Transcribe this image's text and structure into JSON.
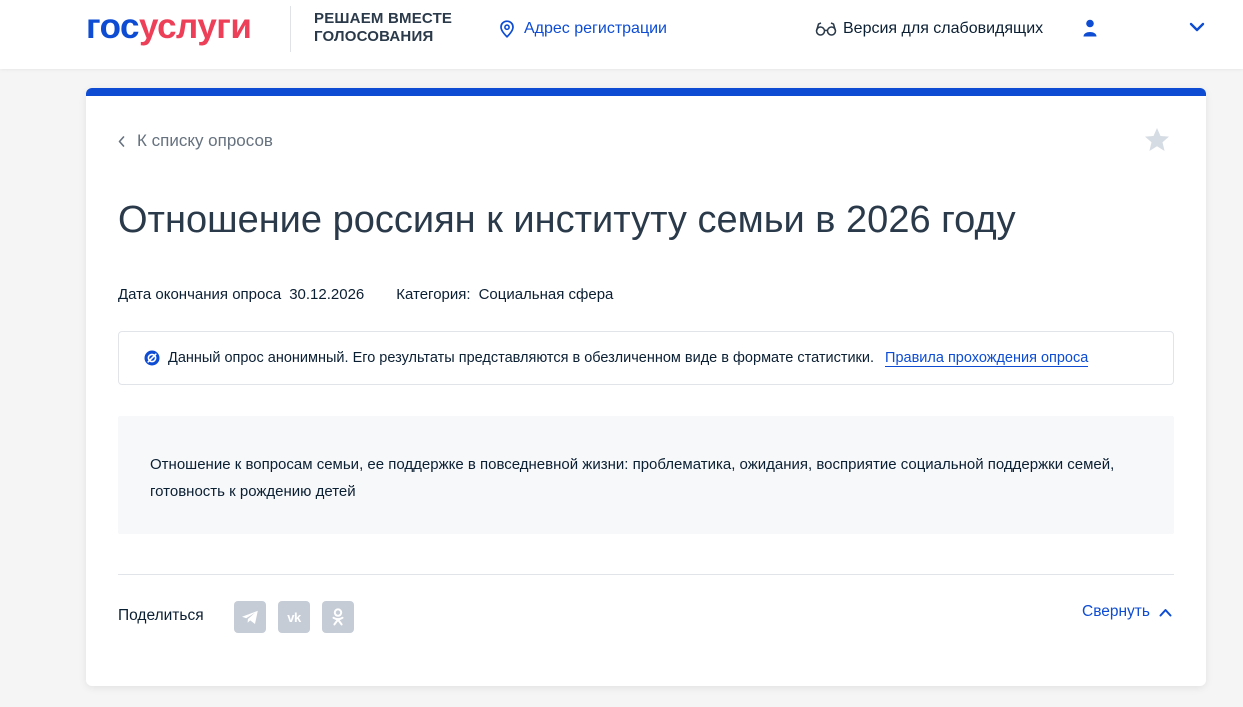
{
  "header": {
    "logo_part1": "гос",
    "logo_part2": "услуги",
    "tagline_line1": "РЕШАЕМ ВМЕСТЕ",
    "tagline_line2": "ГОЛОСОВАНИЯ",
    "address_label": "Адрес регистрации",
    "vision_label": "Версия для слабовидящих"
  },
  "card": {
    "back_label": "К списку опросов",
    "title": "Отношение россиян к институту семьи в 2026 году",
    "end_date_label": "Дата окончания опроса",
    "end_date_value": "30.12.2026",
    "category_label": "Категория:",
    "category_value": "Социальная сфера",
    "notice_text": "Данный опрос анонимный. Его результаты представляются в обезличенном виде в формате статистики.",
    "notice_link": "Правила прохождения опроса",
    "description": "Отношение к вопросам семьи, ее поддержке в повседневной жизни: проблематика, ожидания, восприятие социальной поддержки семей, готовность к рождению детей",
    "share_label": "Поделиться",
    "social": [
      "telegram-icon",
      "vk-icon",
      "odnoklassniki-icon"
    ],
    "collapse_label": "Свернуть"
  },
  "colors": {
    "brand_blue": "#0d4cd3",
    "brand_red": "#ee3f58",
    "social_gray": "#c5ccd6"
  }
}
